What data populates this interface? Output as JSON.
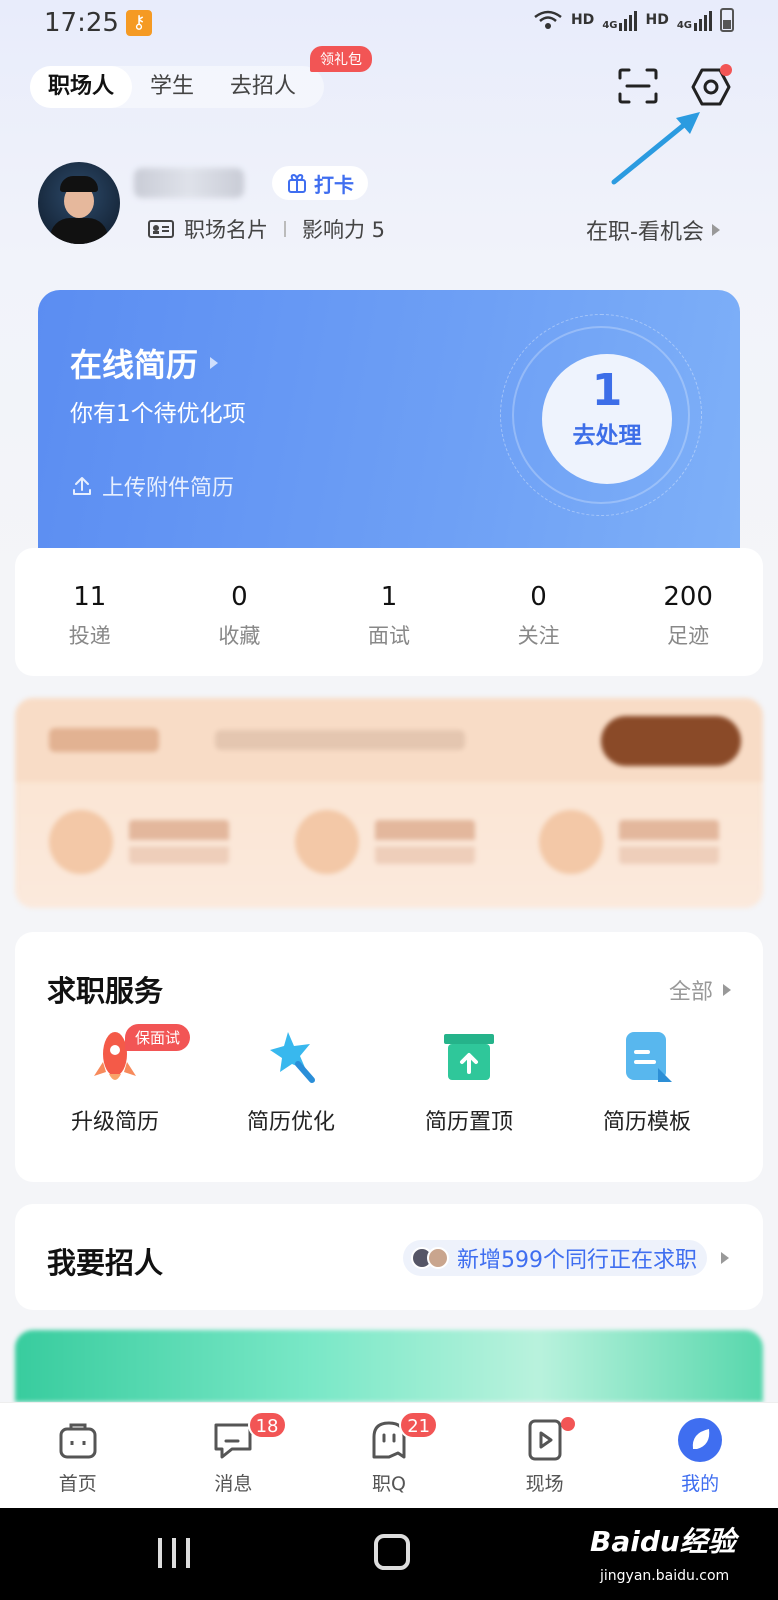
{
  "status_bar": {
    "time": "17:25",
    "hd1": "HD",
    "net1": "4G",
    "hd2": "HD",
    "net2": "4G"
  },
  "top_tabs": [
    {
      "label": "职场人",
      "active": true
    },
    {
      "label": "学生",
      "active": false
    },
    {
      "label": "去招人",
      "active": false
    }
  ],
  "gift_badge": "领礼包",
  "profile": {
    "checkin_label": "打卡",
    "card_label": "职场名片",
    "influence": "影响力 5",
    "job_status": "在职-看机会"
  },
  "resume": {
    "title": "在线简历",
    "subtitle": "你有1个待优化项",
    "upload_label": "上传附件简历",
    "pending_count": "1",
    "action_label": "去处理"
  },
  "stats": [
    {
      "value": "11",
      "label": "投递"
    },
    {
      "value": "0",
      "label": "收藏"
    },
    {
      "value": "1",
      "label": "面试"
    },
    {
      "value": "0",
      "label": "关注"
    },
    {
      "value": "200",
      "label": "足迹"
    }
  ],
  "services": {
    "title": "求职服务",
    "more": "全部",
    "badge": "保面试",
    "items": [
      {
        "label": "升级简历",
        "icon": "rocket-icon"
      },
      {
        "label": "简历优化",
        "icon": "star-icon"
      },
      {
        "label": "简历置顶",
        "icon": "upload-box-icon"
      },
      {
        "label": "简历模板",
        "icon": "template-icon"
      }
    ]
  },
  "recruit": {
    "title": "我要招人",
    "hint": "新增599个同行正在求职"
  },
  "bottom_nav": [
    {
      "label": "首页",
      "badge": ""
    },
    {
      "label": "消息",
      "badge": "18"
    },
    {
      "label": "职Q",
      "badge": "21"
    },
    {
      "label": "现场",
      "badge": ""
    },
    {
      "label": "我的",
      "badge": ""
    }
  ],
  "watermark": {
    "brand": "Baidu经验",
    "url": "jingyan.baidu.com"
  },
  "colors": {
    "accent": "#3f6ef0",
    "badge": "#f25555",
    "resume_card": "#5b8df2"
  }
}
